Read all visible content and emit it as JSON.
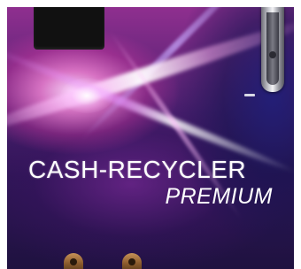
{
  "brand": {
    "name": "CASH-RECYCLER",
    "edition": "PREMIUM"
  },
  "colors": {
    "panel_base": "#2d1554",
    "panel_highlight": "#ff8cdc",
    "text": "#ffffff",
    "handle": "#cfd0d6",
    "card_slot": "#111111"
  }
}
